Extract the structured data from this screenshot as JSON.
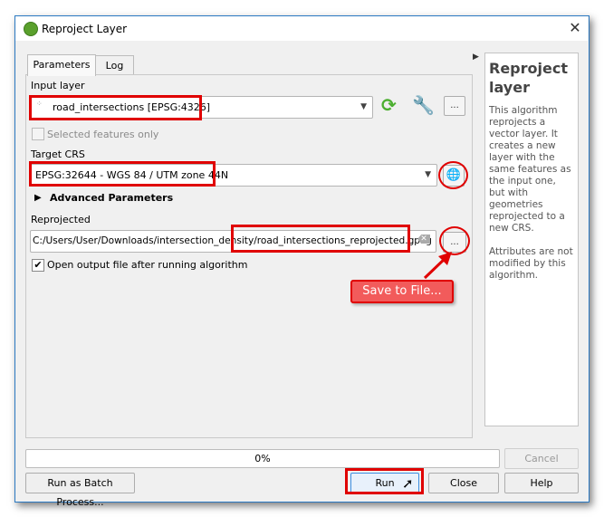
{
  "window": {
    "title": "Reproject Layer",
    "close_icon": "close-icon"
  },
  "tabs": [
    {
      "label": "Parameters",
      "active": true
    },
    {
      "label": "Log",
      "active": false
    }
  ],
  "params": {
    "input_layer_label": "Input layer",
    "input_layer_value": "road_intersections [EPSG:4326]",
    "selected_only_label": "Selected features only",
    "selected_only_checked": false,
    "target_crs_label": "Target CRS",
    "target_crs_value": "EPSG:32644 - WGS 84 / UTM zone 44N",
    "advanced_label": "Advanced Parameters",
    "reprojected_label": "Reprojected",
    "reprojected_value": "C:/Users/User/Downloads/intersection_density/road_intersections_reprojected.gpkg",
    "open_output_label": "Open output file after running algorithm",
    "open_output_checked": true,
    "ellipsis": "...",
    "checkmark": "✔"
  },
  "annotation": {
    "callout": "Save to File...",
    "color": "#e00000"
  },
  "help": {
    "title": "Reproject layer",
    "p1": "This algorithm reprojects a vector layer. It creates a new layer with the same features as the input one, but with geometries reprojected to a new CRS.",
    "p2": "Attributes are not modified by this algorithm."
  },
  "footer": {
    "progress_text": "0%",
    "progress_value": 0,
    "cancel": "Cancel",
    "batch": "Run as Batch Process...",
    "run": "Run",
    "close": "Close",
    "help": "Help"
  }
}
